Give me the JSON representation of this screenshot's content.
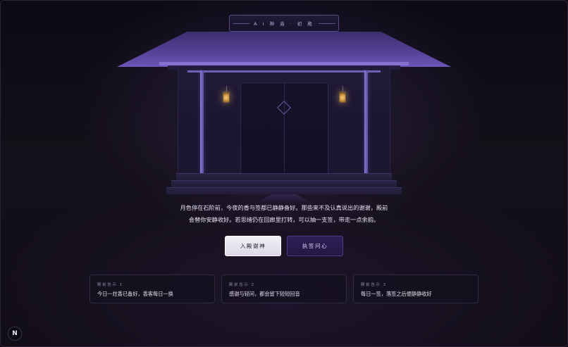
{
  "temple": {
    "plaque_text": "A I 神 庙 · 初 殿",
    "icons": [
      "lantern-icon",
      "diamond-ornament-icon"
    ]
  },
  "narration": {
    "line1": "月色停在石阶前，今夜的香与签都已静静备好。那些来不及认真说出的谢谢，殿前",
    "line2": "会替你安静收好。若思绪仍在回廊里打转，可以抽一支签，带走一点余韵。"
  },
  "actions": {
    "enter_label": "入殿谢神",
    "draw_label": "执签问心"
  },
  "hints": [
    {
      "label": "殿前告示 1",
      "text": "今日一炷香已备好，香客每日一换"
    },
    {
      "label": "殿前告示 2",
      "text": "感谢与轻问，都会留下短短回音"
    },
    {
      "label": "殿前告示 3",
      "text": "每日一签，落签之后便静静收好"
    }
  ],
  "corner": {
    "logo_letter": "N"
  },
  "colors": {
    "accent": "#8b78d6",
    "background": "#120e18",
    "lantern": "#f4cf7a"
  }
}
